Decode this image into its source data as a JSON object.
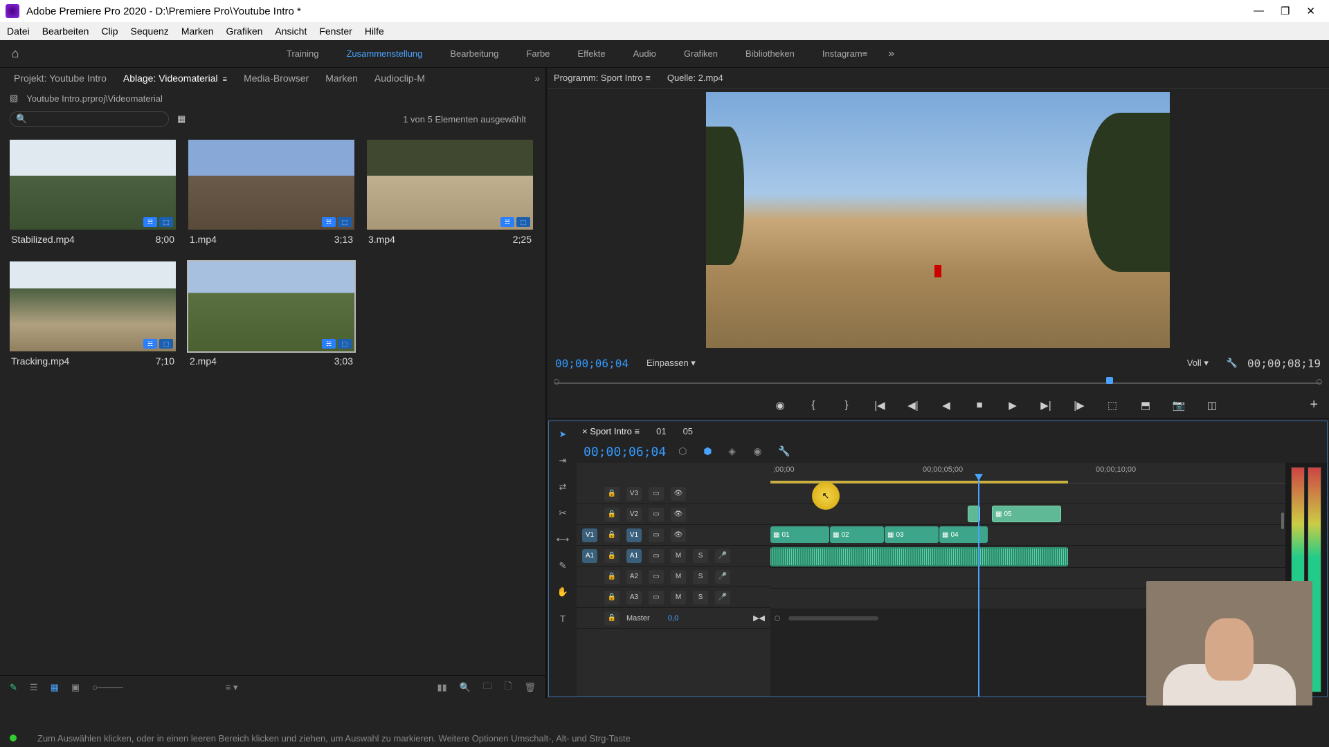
{
  "titlebar": {
    "app": "Adobe Premiere Pro 2020",
    "file": "D:\\Premiere Pro\\Youtube Intro *"
  },
  "menus": [
    "Datei",
    "Bearbeiten",
    "Clip",
    "Sequenz",
    "Marken",
    "Grafiken",
    "Ansicht",
    "Fenster",
    "Hilfe"
  ],
  "workspaces": [
    "Training",
    "Zusammenstellung",
    "Bearbeitung",
    "Farbe",
    "Effekte",
    "Audio",
    "Grafiken",
    "Bibliotheken",
    "Instagram"
  ],
  "workspace_active": "Zusammenstellung",
  "project_tabs": [
    {
      "label": "Projekt: Youtube Intro"
    },
    {
      "label": "Ablage: Videomaterial",
      "active": true
    },
    {
      "label": "Media-Browser"
    },
    {
      "label": "Marken"
    },
    {
      "label": "Audioclip-M"
    }
  ],
  "bin": {
    "path": "Youtube Intro.prproj\\Videomaterial",
    "selection": "1 von 5 Elementen ausgewählt",
    "items": [
      {
        "name": "Stabilized.mp4",
        "dur": "8;00"
      },
      {
        "name": "1.mp4",
        "dur": "3;13"
      },
      {
        "name": "3.mp4",
        "dur": "2;25"
      },
      {
        "name": "Tracking.mp4",
        "dur": "7;10"
      },
      {
        "name": "2.mp4",
        "dur": "3;03",
        "selected": true
      }
    ]
  },
  "program": {
    "tab": "Programm: Sport Intro",
    "source_tab": "Quelle: 2.mp4",
    "tc": "00;00;06;04",
    "fit": "Einpassen",
    "quality": "Voll",
    "duration": "00;00;08;19"
  },
  "timeline": {
    "tabs": [
      "Sport Intro",
      "01",
      "05"
    ],
    "tc": "00;00;06;04",
    "ruler": [
      ";00;00",
      "00;00;05;00",
      "00;00;10;00"
    ],
    "video_tracks": [
      "V3",
      "V2",
      "V1"
    ],
    "audio_tracks": [
      "A1",
      "A2",
      "A3"
    ],
    "master": "Master",
    "master_val": "0,0",
    "clips_v1": [
      "01",
      "02",
      "03",
      "04"
    ],
    "clip_v2": "05"
  },
  "status": "Zum Auswählen klicken, oder in einen leeren Bereich klicken und ziehen, um Auswahl zu markieren. Weitere Optionen Umschalt-, Alt- und Strg-Taste",
  "icons": {
    "home": "⌂",
    "search": "🔍",
    "menu": "≡",
    "more": "»",
    "wrench": "🔧",
    "add": "+",
    "lock": "🔒",
    "eye": "👁",
    "mute": "M",
    "solo": "S",
    "mic": "🎤",
    "pen": "✎"
  }
}
